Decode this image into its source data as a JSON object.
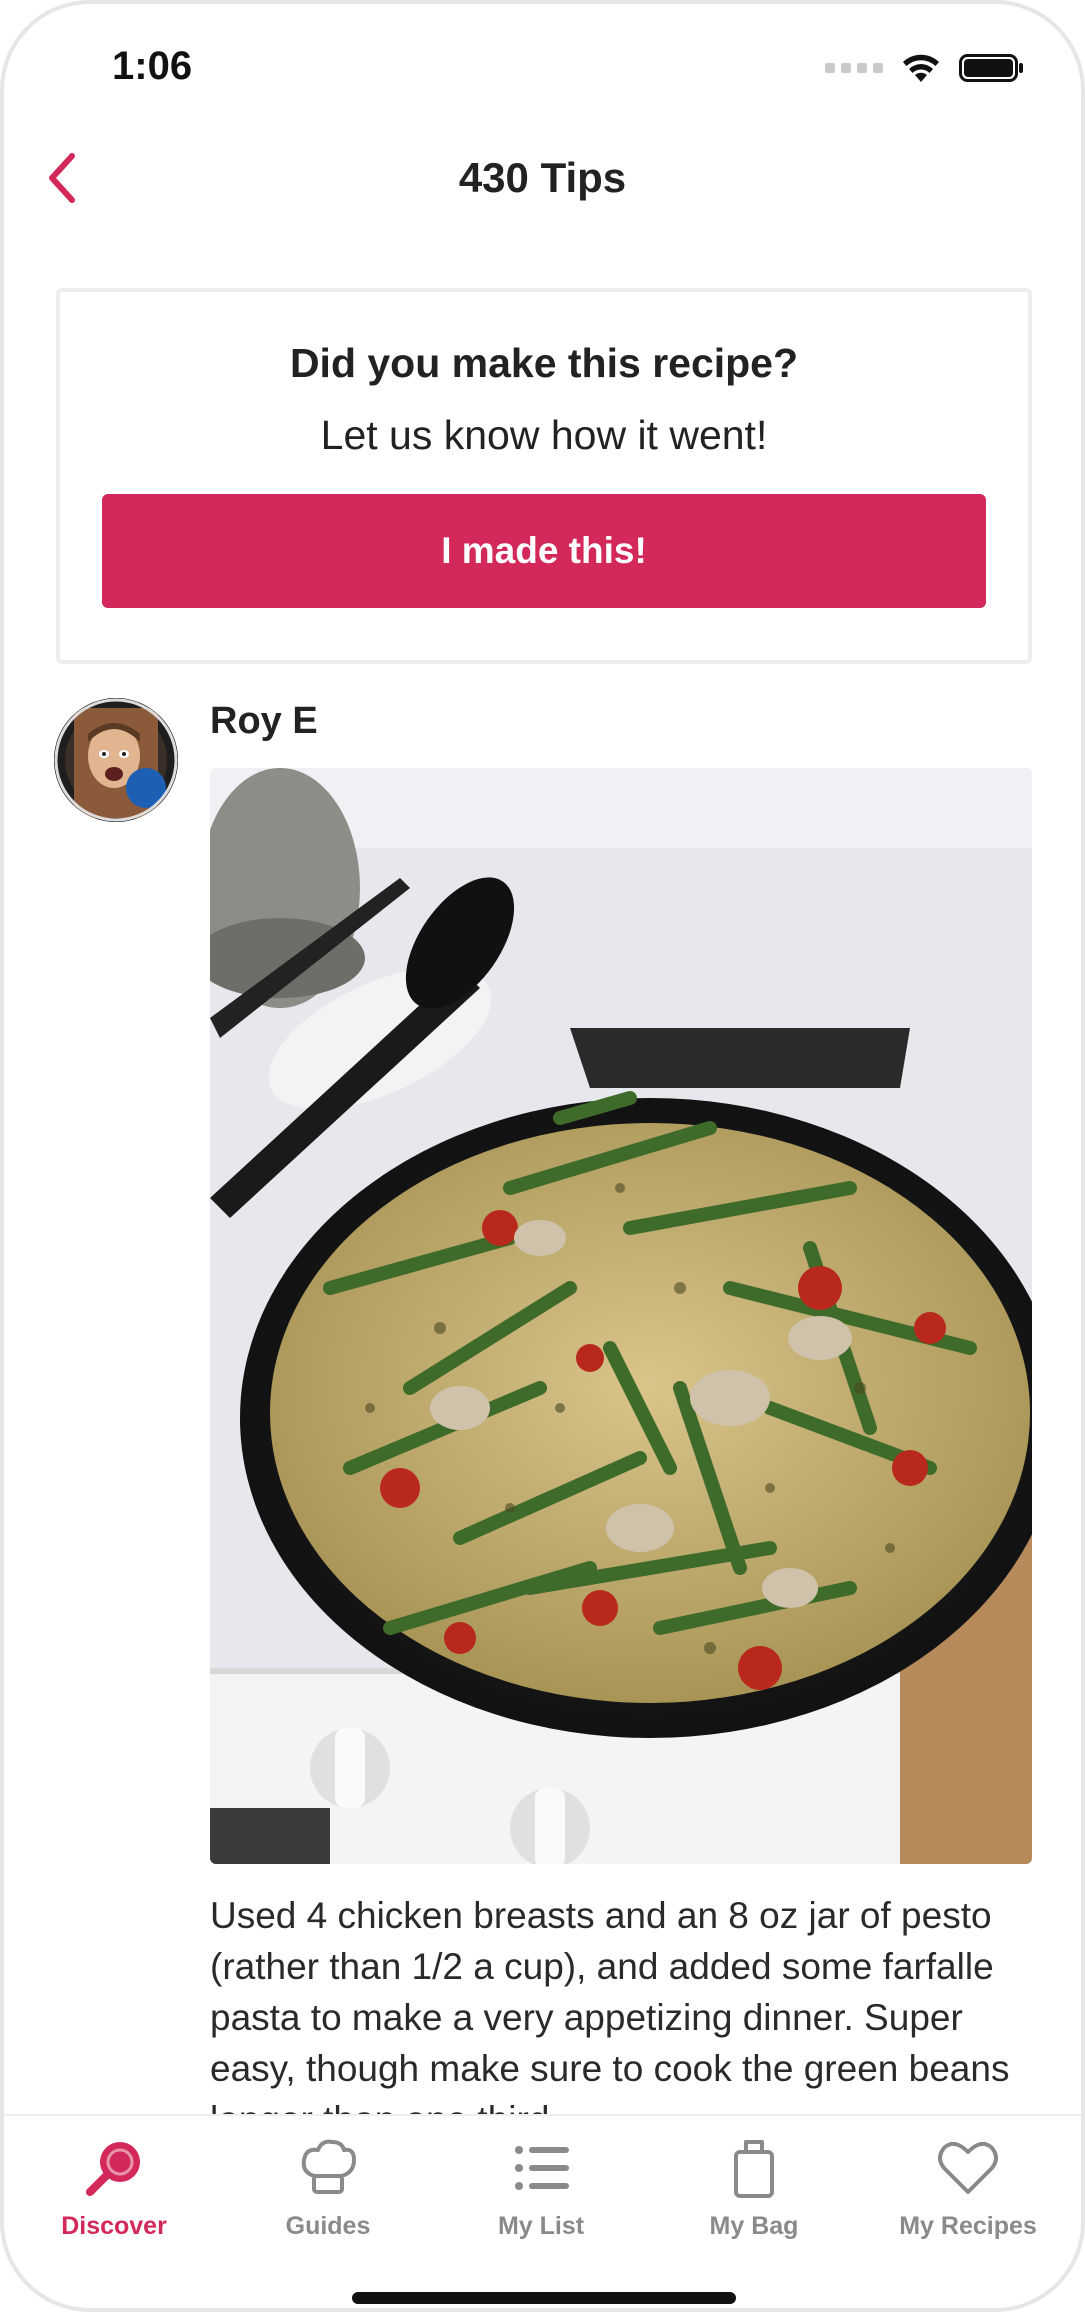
{
  "status_bar": {
    "time": "1:06",
    "icons": [
      "signal-icon",
      "wifi-icon",
      "battery-icon"
    ]
  },
  "header": {
    "title": "430 Tips",
    "back_icon": "chevron-left-icon"
  },
  "cta": {
    "heading": "Did you make this recipe?",
    "subheading": "Let us know how it went!",
    "button_label": "I made this!"
  },
  "tip": {
    "author": "Roy E",
    "photo": "pan of farfalle pasta with chicken, green beans and tomatoes on stove",
    "text": "Used 4 chicken breasts and an 8 oz jar of pesto (rather than 1/2 a cup), and added some farfalle pasta to make a very appetizing dinner. Super easy, though make sure to cook the green beans longer than one third"
  },
  "tabs": [
    {
      "label": "Discover",
      "icon": "search-icon",
      "active": true
    },
    {
      "label": "Guides",
      "icon": "chef-hat-icon",
      "active": false
    },
    {
      "label": "My List",
      "icon": "list-icon",
      "active": false
    },
    {
      "label": "My Bag",
      "icon": "shopping-bag-icon",
      "active": false
    },
    {
      "label": "My Recipes",
      "icon": "heart-icon",
      "active": false
    }
  ],
  "colors": {
    "accent": "#d3285a",
    "tab_inactive": "#8a8a8a",
    "card_border": "#ededed"
  }
}
